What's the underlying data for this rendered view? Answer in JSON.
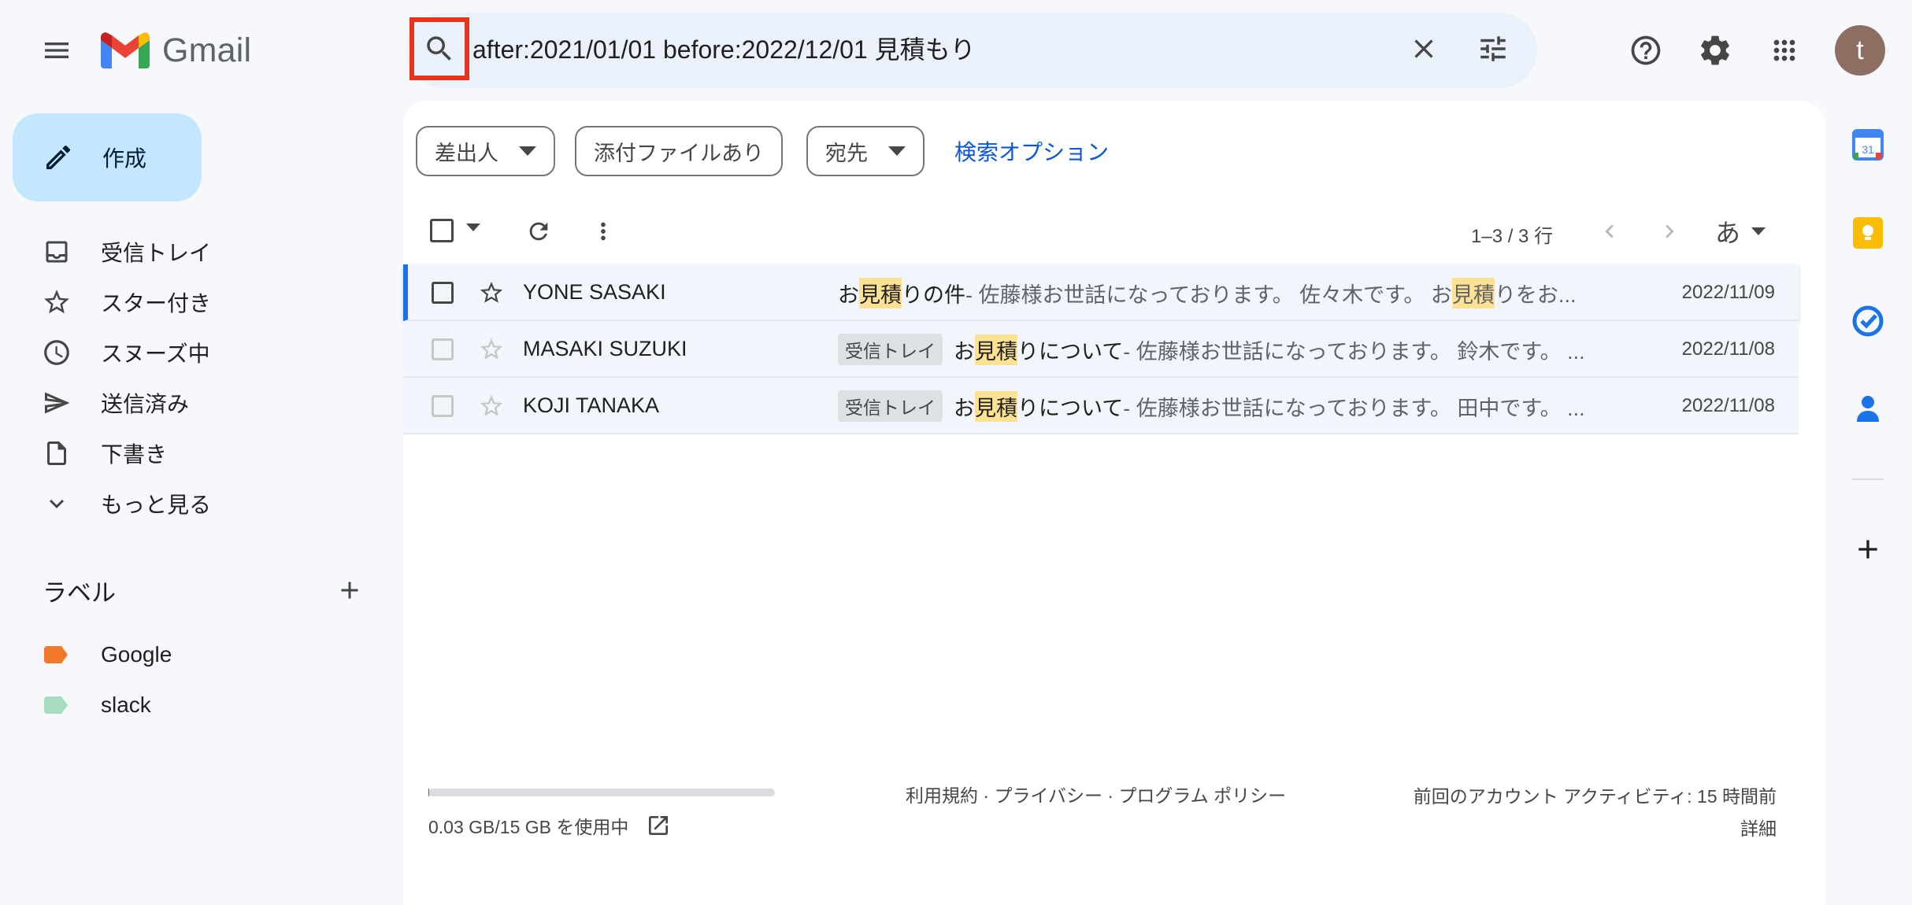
{
  "app": {
    "name": "Gmail"
  },
  "search": {
    "query": "after:2021/01/01 before:2022/12/01 見積もり"
  },
  "account": {
    "avatar_letter": "t",
    "avatar_color": "#8d6e63"
  },
  "compose": {
    "label": "作成"
  },
  "sidebar": {
    "items": [
      {
        "label": "受信トレイ",
        "icon": "inbox-icon"
      },
      {
        "label": "スター付き",
        "icon": "star-icon"
      },
      {
        "label": "スヌーズ中",
        "icon": "clock-icon"
      },
      {
        "label": "送信済み",
        "icon": "send-icon"
      },
      {
        "label": "下書き",
        "icon": "draft-icon"
      },
      {
        "label": "もっと見る",
        "icon": "chevron-down-icon"
      }
    ],
    "labels_header": "ラベル",
    "labels": [
      {
        "name": "Google",
        "color": "#f2792b"
      },
      {
        "name": "slack",
        "color": "#a8dcc0"
      }
    ]
  },
  "filters": {
    "from": "差出人",
    "has_attachment": "添付ファイルあり",
    "to": "宛先",
    "advanced": "検索オプション"
  },
  "toolbar": {
    "count": "1–3 / 3 行",
    "input_tool": "あ"
  },
  "emails": [
    {
      "sender": "YONE SASAKI",
      "badge": "",
      "subject_pre": "お",
      "subject_hl": "見積",
      "subject_post": "りの件",
      "snippet_pre": " - 佐藤様お世話になっております。 佐々木です。 お",
      "snippet_hl": "見積",
      "snippet_post": "りをお...",
      "date": "2022/11/09"
    },
    {
      "sender": "MASAKI SUZUKI",
      "badge": "受信トレイ",
      "subject_pre": "お",
      "subject_hl": "見積",
      "subject_post": "りについて",
      "snippet_pre": " - 佐藤様お世話になっております。 鈴木です。 ...",
      "snippet_hl": "",
      "snippet_post": "",
      "date": "2022/11/08"
    },
    {
      "sender": "KOJI TANAKA",
      "badge": "受信トレイ",
      "subject_pre": "お",
      "subject_hl": "見積",
      "subject_post": "りについて",
      "snippet_pre": " - 佐藤様お世話になっております。 田中です。 ...",
      "snippet_hl": "",
      "snippet_post": "",
      "date": "2022/11/08"
    }
  ],
  "footer": {
    "storage": "0.03 GB/15 GB を使用中",
    "storage_used_fraction": 0.002,
    "links": "利用規約 · プライバシー · プログラム ポリシー",
    "activity": "前回のアカウント アクティビティ: 15 時間前",
    "details": "詳細"
  },
  "colors": {
    "compose_bg": "#c2e7ff",
    "search_bg": "#eaf1fb",
    "highlight": "#fde293",
    "link": "#0b57d0",
    "search_icon_frame": "#e8341c"
  },
  "right_rail": {
    "calendar_day": "31"
  }
}
